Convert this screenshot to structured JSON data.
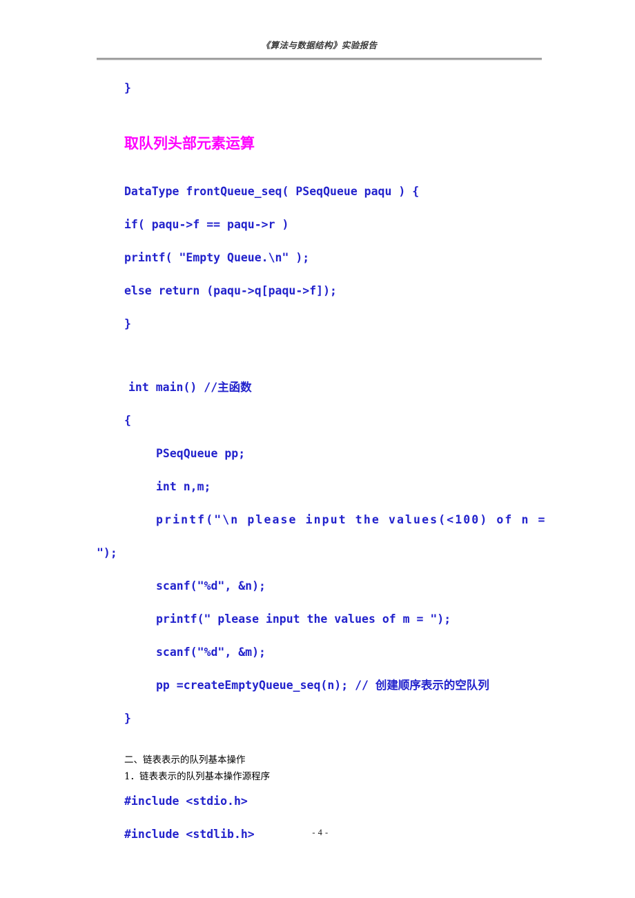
{
  "document": {
    "header_title": "《算法与数据结构》实验报告",
    "page_number": "- 4 -",
    "colors": {
      "code_blue": "#2222cc",
      "heading_magenta": "#ff00ff",
      "body_black": "#000000",
      "header_gray": "#3a3a3a"
    }
  },
  "lines": {
    "close_brace_1": "}",
    "section_heading": "取队列头部元素运算",
    "front_sig": "DataType frontQueue_seq( PSeqQueue paqu ) {",
    "front_if": "if( paqu->f == paqu->r )",
    "front_printf": "printf( \"Empty Queue.\\n\" );",
    "front_else": "else return (paqu->q[paqu->f]);",
    "close_brace_2": "}",
    "main_sig": "int main() //主函数",
    "main_open": "{",
    "decl_queue": "PSeqQueue pp;",
    "decl_int": "int n,m;",
    "printf_n_part1": "printf(\"\\n please input the values(<100) of n =",
    "printf_n_part2": "\");",
    "scanf_n": "scanf(\"%d\", &n);",
    "printf_m": "printf(\" please input the values of m = \");",
    "scanf_m": "scanf(\"%d\", &m);",
    "create_queue": "pp =createEmptyQueue_seq(n); // 创建顺序表示的空队列",
    "close_brace_3": "}",
    "section_two": "二、链表表示的队列基本操作",
    "subsection_one": "1．链表表示的队列基本操作源程序",
    "include_stdio": "#include <stdio.h>",
    "include_stdlib": "#include <stdlib.h>"
  }
}
